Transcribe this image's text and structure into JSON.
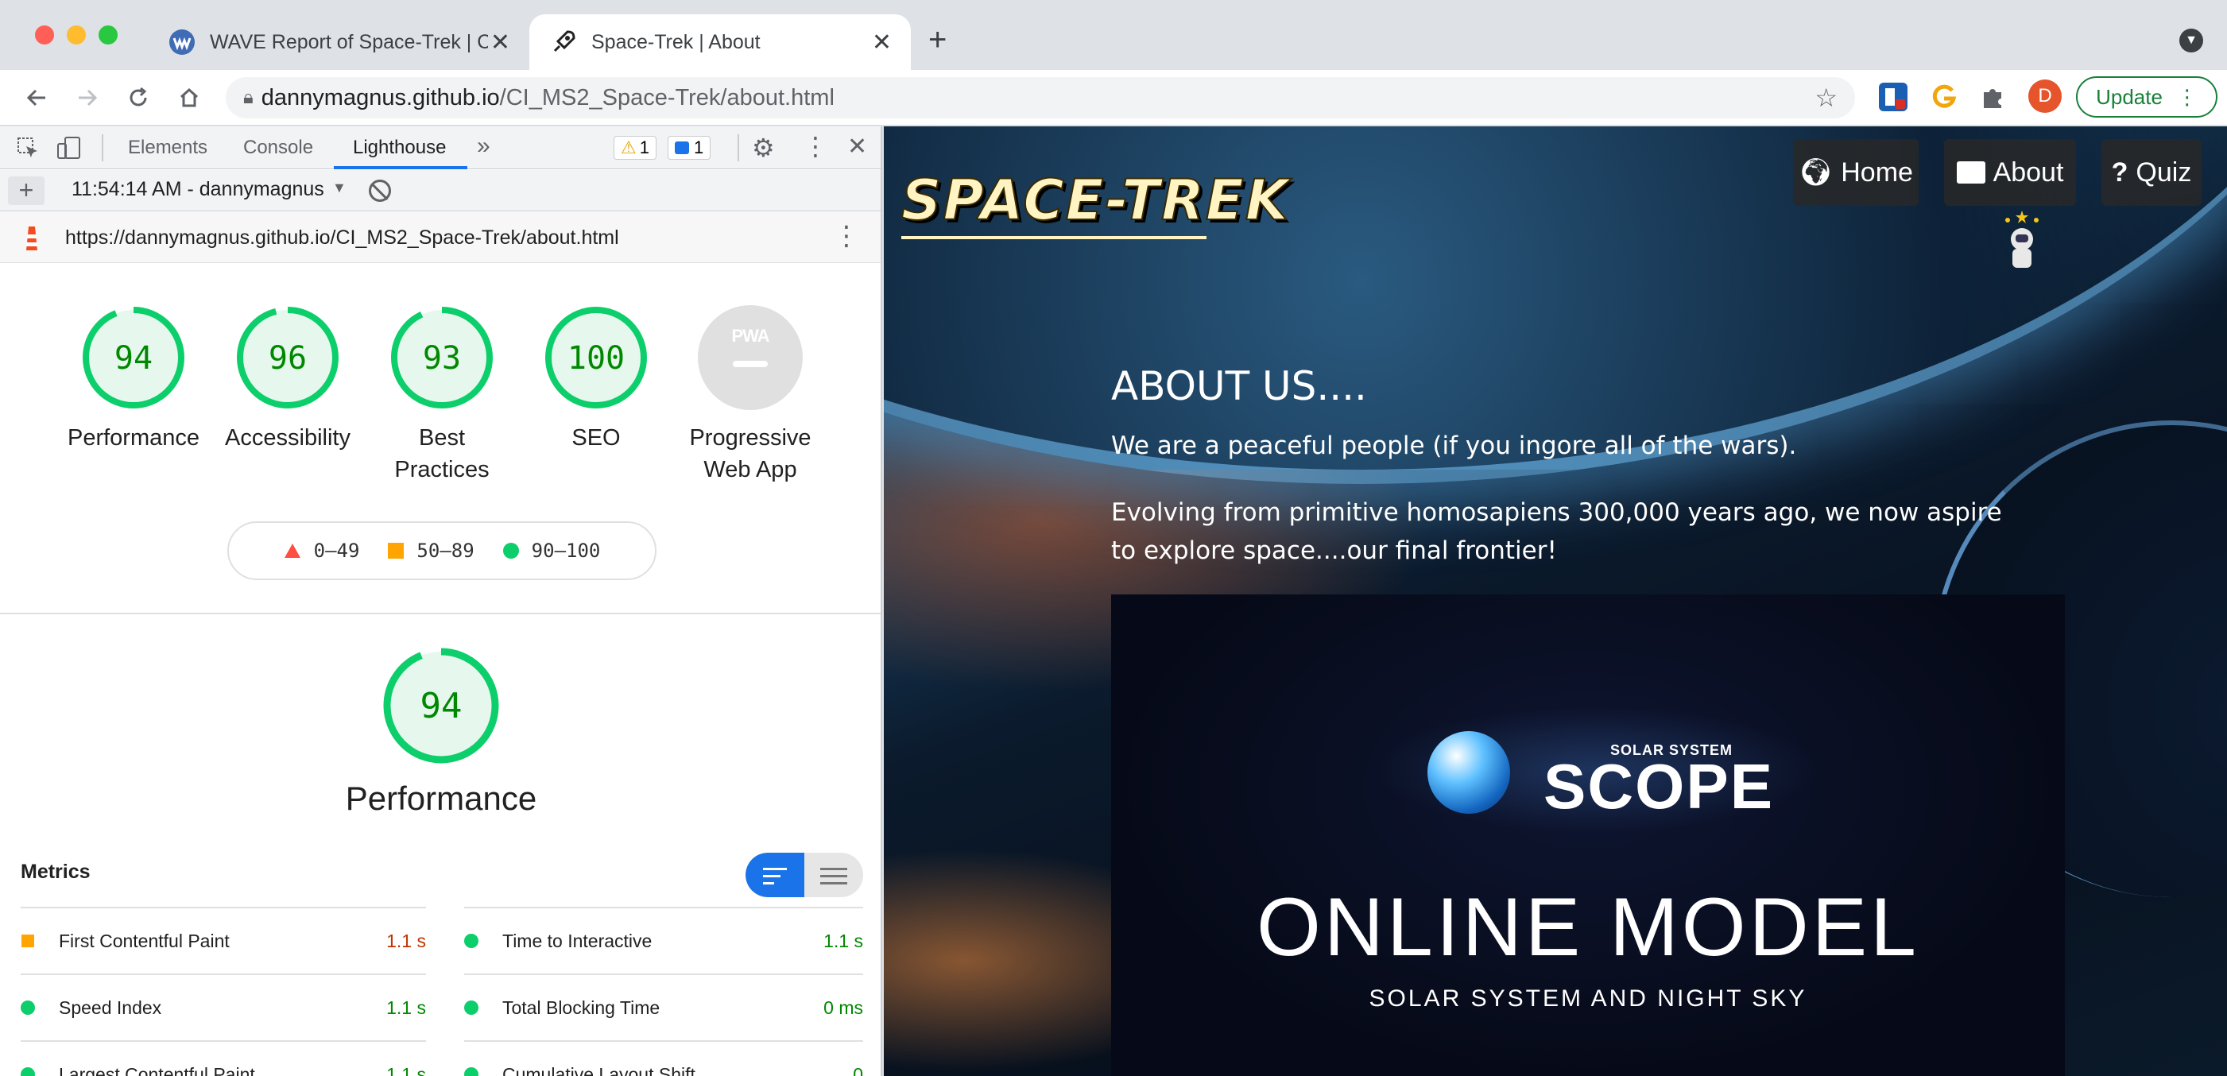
{
  "browser": {
    "tabs": [
      {
        "title": "WAVE Report of Space-Trek | C",
        "active": false
      },
      {
        "title": "Space-Trek | About",
        "active": true
      }
    ],
    "url_host": "dannymagnus.github.io",
    "url_path": "/CI_MS2_Space-Trek/about.html",
    "update_label": "Update",
    "profile_initial": "D"
  },
  "devtools": {
    "tabs": [
      "Elements",
      "Console",
      "Lighthouse"
    ],
    "active_tab": "Lighthouse",
    "warning_count": "1",
    "message_count": "1",
    "report_time": "11:54:14 AM - dannymagnus.",
    "report_url": "https://dannymagnus.github.io/CI_MS2_Space-Trek/about.html",
    "scores": [
      {
        "score": "94",
        "label_line1": "Performance",
        "label_line2": ""
      },
      {
        "score": "96",
        "label_line1": "Accessibility",
        "label_line2": ""
      },
      {
        "score": "93",
        "label_line1": "Best",
        "label_line2": "Practices"
      },
      {
        "score": "100",
        "label_line1": "SEO",
        "label_line2": ""
      }
    ],
    "pwa": {
      "badge": "PWA",
      "label_line1": "Progressive",
      "label_line2": "Web App"
    },
    "legend": [
      "0–49",
      "50–89",
      "90–100"
    ],
    "perf_score": "94",
    "perf_title": "Performance",
    "metrics_title": "Metrics",
    "metrics": [
      {
        "name": "First Contentful Paint",
        "value": "1.1 s",
        "status": "average"
      },
      {
        "name": "Time to Interactive",
        "value": "1.1 s",
        "status": "pass"
      },
      {
        "name": "Speed Index",
        "value": "1.1 s",
        "status": "pass"
      },
      {
        "name": "Total Blocking Time",
        "value": "0 ms",
        "status": "pass"
      },
      {
        "name": "Largest Contentful Paint",
        "value": "1.1 s",
        "status": "pass"
      },
      {
        "name": "Cumulative Layout Shift",
        "value": "0",
        "status": "pass"
      }
    ]
  },
  "site": {
    "logo": "SPACE-TREK",
    "nav": {
      "home": "Home",
      "about": "About",
      "quiz": "Quiz"
    },
    "heading": "ABOUT US....",
    "para1": "We are a peaceful people (if you ingore all of the wars).",
    "para2": "Evolving from primitive homosapiens 300,000 years ago, we now aspire to explore space....our final frontier!",
    "video": {
      "brand_small": "SOLAR SYSTEM",
      "brand_big": "SCOPE",
      "title": "ONLINE MODEL",
      "subtitle": "SOLAR SYSTEM AND NIGHT SKY"
    }
  },
  "colors": {
    "pass": "#0cce6b",
    "average": "#ffa400",
    "fail": "#ff4e42",
    "pass_text": "#008800",
    "average_text": "#c33300"
  }
}
